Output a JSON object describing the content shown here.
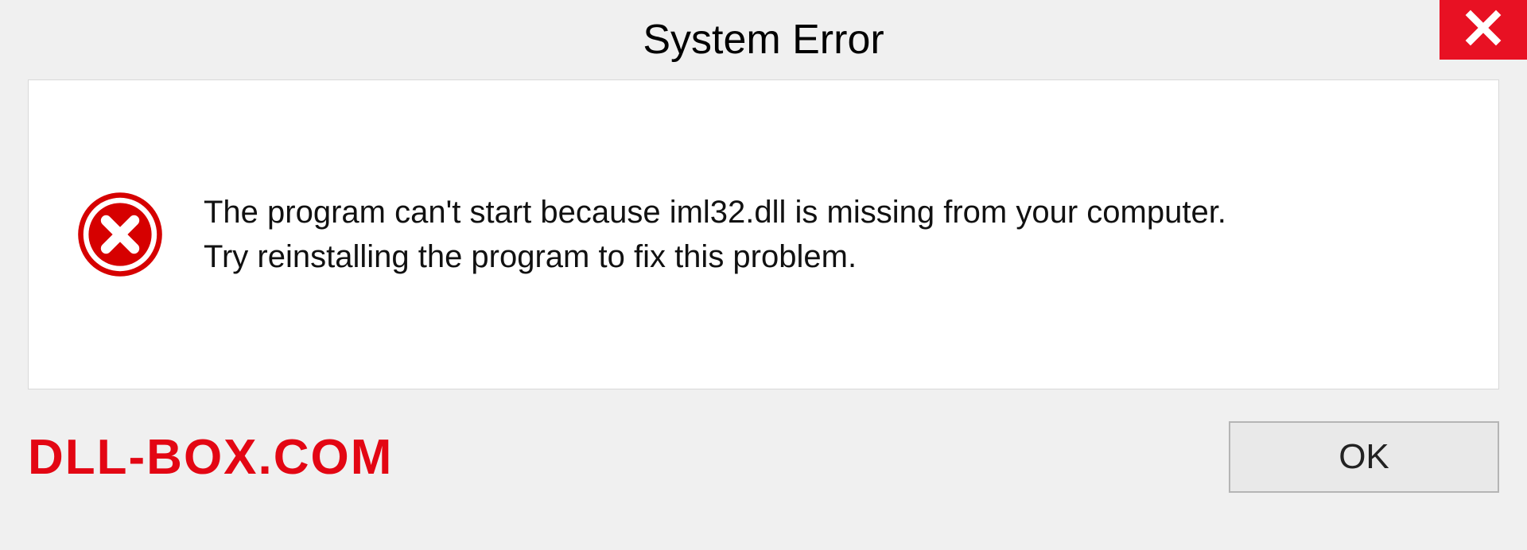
{
  "title": "System Error",
  "message_line1": "The program can't start because iml32.dll is missing from your computer.",
  "message_line2": "Try reinstalling the program to fix this problem.",
  "ok_label": "OK",
  "watermark": "DLL-BOX.COM",
  "colors": {
    "close_bg": "#e81123",
    "error_icon": "#d60000",
    "watermark": "#e30613"
  }
}
